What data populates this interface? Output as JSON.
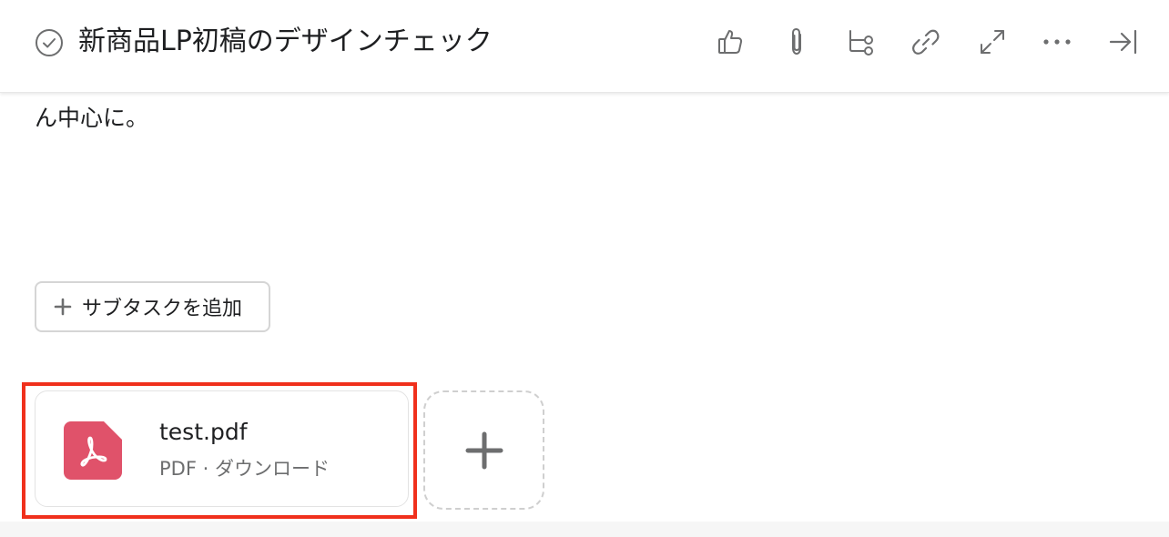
{
  "task": {
    "title": "新商品LP初稿のデザインチェック",
    "description_tail": "ん中心に。"
  },
  "toolbar": {
    "icons": [
      "thumbs-up-icon",
      "paperclip-icon",
      "subtask-icon",
      "link-icon",
      "expand-icon",
      "more-icon",
      "close-pane-icon"
    ]
  },
  "subtask": {
    "add_label": "サブタスクを追加"
  },
  "attachment": {
    "file_name": "test.pdf",
    "file_meta": "PDF · ダウンロード",
    "icon": "pdf-icon",
    "icon_color": "#e0526a"
  },
  "colors": {
    "highlight": "#f0301c",
    "icon_gray": "#6d6e6f"
  }
}
